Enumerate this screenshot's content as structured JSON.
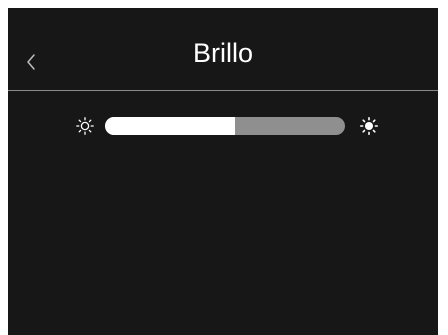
{
  "header": {
    "title": "Brillo",
    "back_icon": "chevron-left-icon"
  },
  "brightness": {
    "level": 0.54,
    "min_icon": "sun-outline-icon",
    "max_icon": "sun-filled-icon"
  },
  "colors": {
    "background": "#171717",
    "text": "#ffffff",
    "divider": "#8a8a8a",
    "slider_fill": "#ffffff",
    "slider_track": "#8f8f8f"
  }
}
